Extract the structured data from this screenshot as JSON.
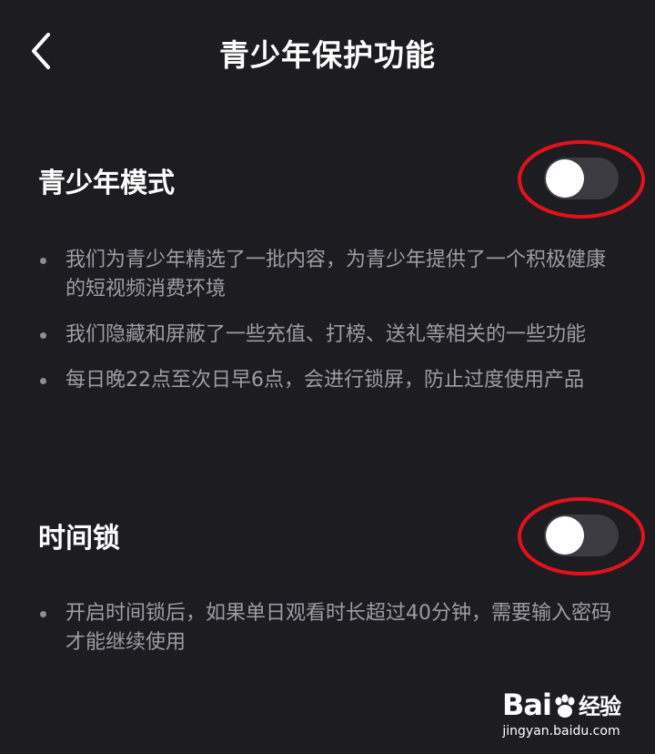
{
  "header": {
    "title": "青少年保护功能"
  },
  "teen_mode": {
    "title": "青少年模式",
    "enabled": false,
    "bullets": [
      "我们为青少年精选了一批内容，为青少年提供了一个积极健康的短视频消费环境",
      "我们隐藏和屏蔽了一些充值、打榜、送礼等相关的一些功能",
      "每日晚22点至次日早6点，会进行锁屏，防止过度使用产品"
    ]
  },
  "time_lock": {
    "title": "时间锁",
    "enabled": false,
    "bullets": [
      "开启时间锁后，如果单日观看时长超过40分钟，需要输入密码才能继续使用"
    ]
  },
  "watermark": {
    "logo_text": "Bai",
    "logo_suffix": "经验",
    "url": "jingyan.baidu.com"
  },
  "colors": {
    "background": "#1d1c21",
    "toggle_track": "#3c3b41",
    "annotation_ring": "#e0121b",
    "bullet_text": "#9d9ca3"
  }
}
